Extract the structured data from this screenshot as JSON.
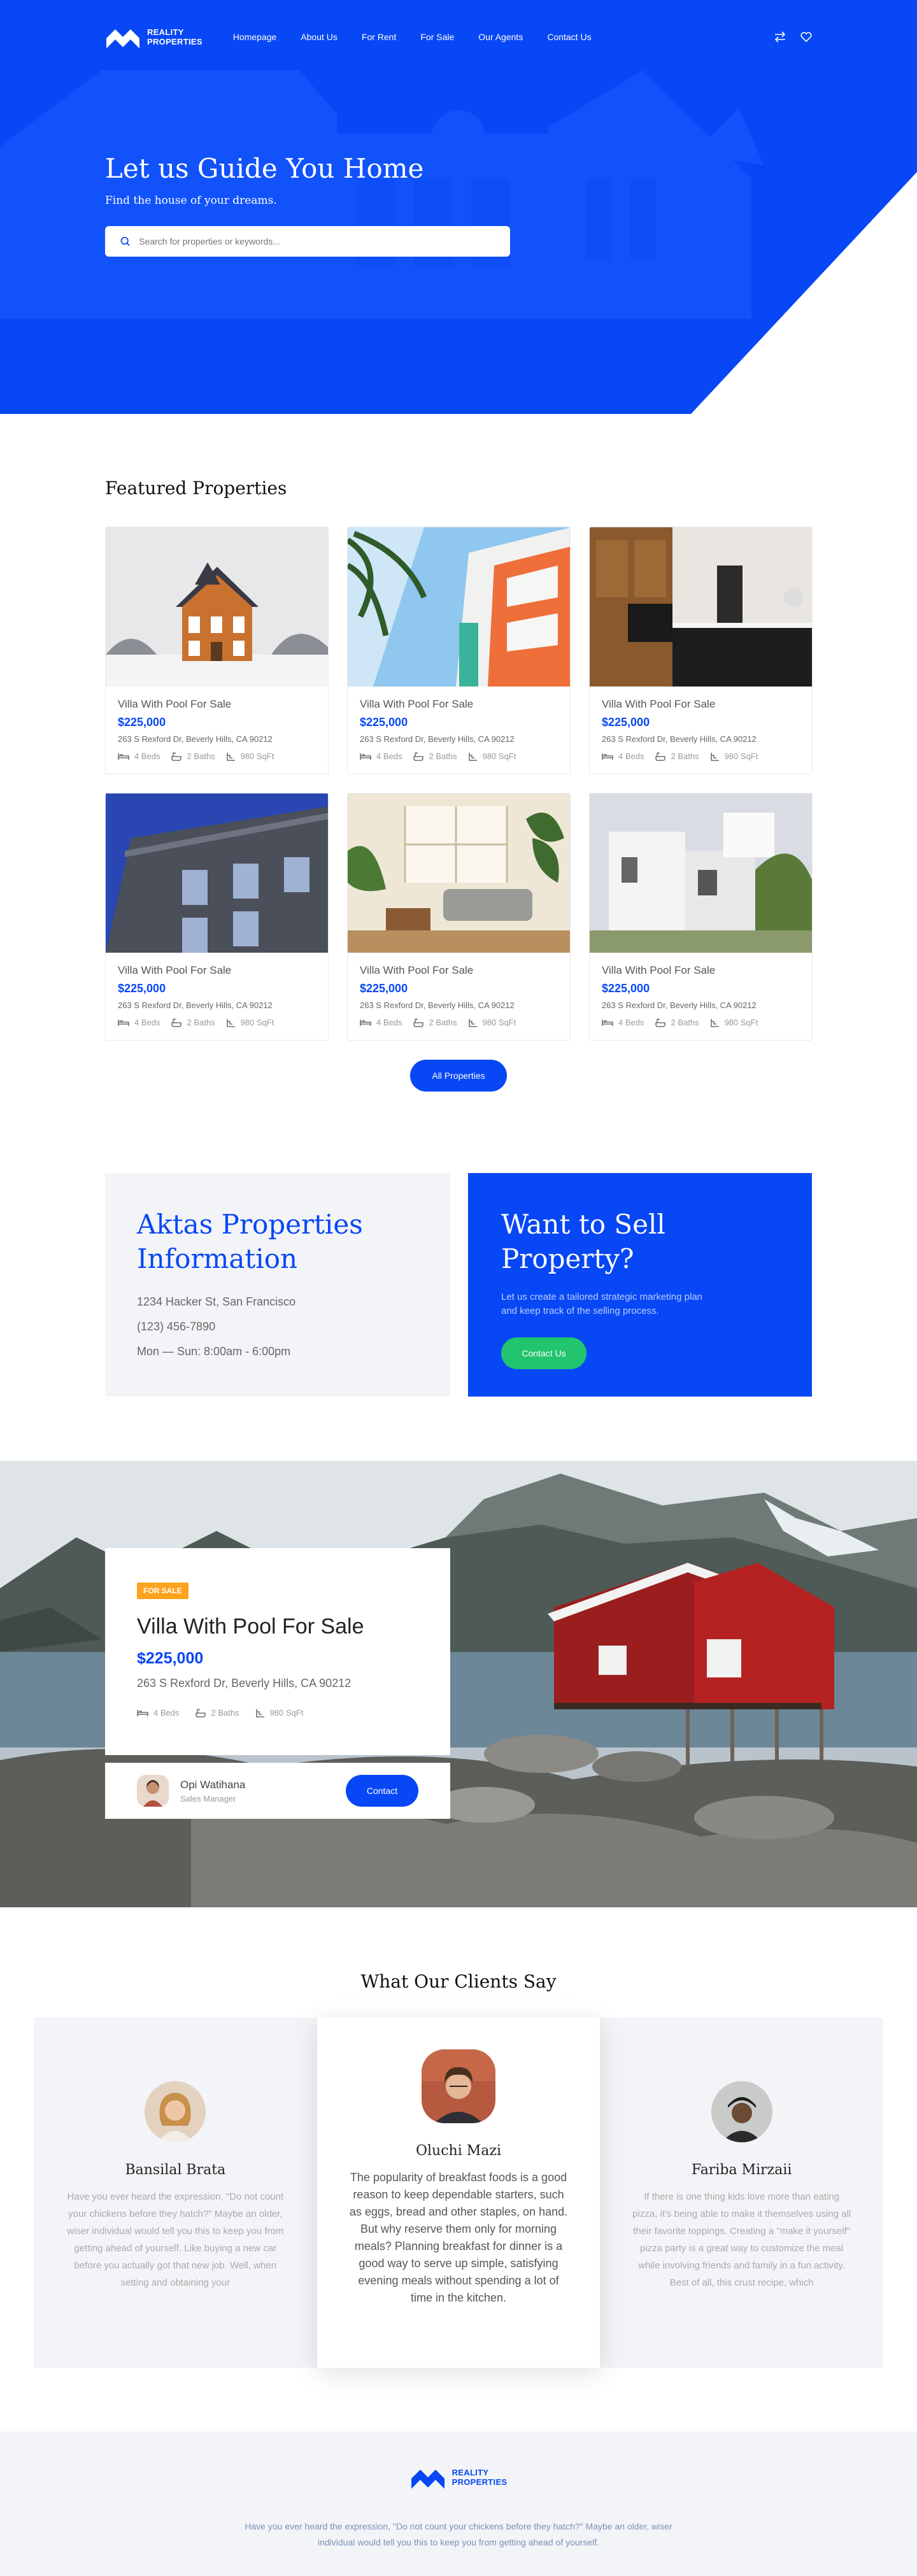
{
  "brand": {
    "line1": "REALITY",
    "line2": "PROPERTIES"
  },
  "nav": {
    "links": [
      "Homepage",
      "About Us",
      "For Rent",
      "For Sale",
      "Our Agents",
      "Contact Us"
    ]
  },
  "hero": {
    "title": "Let us Guide You Home",
    "subtitle": "Find the house of your dreams.",
    "search_placeholder": "Search for properties or keywords..."
  },
  "featured": {
    "title": "Featured Properties",
    "cards": [
      {
        "title": "Villa With Pool For Sale",
        "price": "$225,000",
        "address": "263 S Rexford Dr, Beverly Hills, CA 90212",
        "beds": "4 Beds",
        "baths": "2 Baths",
        "area": "980 SqFt"
      },
      {
        "title": "Villa With Pool For Sale",
        "price": "$225,000",
        "address": "263 S Rexford Dr, Beverly Hills, CA 90212",
        "beds": "4 Beds",
        "baths": "2 Baths",
        "area": "980 SqFt"
      },
      {
        "title": "Villa With Pool For Sale",
        "price": "$225,000",
        "address": "263 S Rexford Dr, Beverly Hills, CA 90212",
        "beds": "4 Beds",
        "baths": "2 Baths",
        "area": "980 SqFt"
      },
      {
        "title": "Villa With Pool For Sale",
        "price": "$225,000",
        "address": "263 S Rexford Dr, Beverly Hills, CA 90212",
        "beds": "4 Beds",
        "baths": "2 Baths",
        "area": "980 SqFt"
      },
      {
        "title": "Villa With Pool For Sale",
        "price": "$225,000",
        "address": "263 S Rexford Dr, Beverly Hills, CA 90212",
        "beds": "4 Beds",
        "baths": "2 Baths",
        "area": "980 SqFt"
      },
      {
        "title": "Villa With Pool For Sale",
        "price": "$225,000",
        "address": "263 S Rexford Dr, Beverly Hills, CA 90212",
        "beds": "4 Beds",
        "baths": "2 Baths",
        "area": "980 SqFt"
      }
    ],
    "all_button": "All Properties"
  },
  "info": {
    "title_line1": "Aktas Properties",
    "title_line2": "Information",
    "address": "1234 Hacker St, San Francisco",
    "phone": "(123) 456-7890",
    "hours": "Mon — Sun: 8:00am - 6:00pm"
  },
  "sell": {
    "title_line1": "Want to Sell",
    "title_line2": "Property?",
    "description": "Let us create a tailored strategic marketing plan and keep track of the selling process.",
    "button": "Contact Us"
  },
  "listing": {
    "badge": "FOR SALE",
    "title": "Villa With Pool For Sale",
    "price": "$225,000",
    "address": "263 S Rexford Dr, Beverly Hills, CA 90212",
    "beds": "4 Beds",
    "baths": "2 Baths",
    "area": "980 SqFt",
    "agent_name": "Opi Watihana",
    "agent_role": "Sales Manager",
    "contact_button": "Contact"
  },
  "testimonials": {
    "title": "What Our Clients Say",
    "items": [
      {
        "name": "Bansilal Brata",
        "text": "Have you ever heard the expression, \"Do not count your chickens before they hatch?\" Maybe an older, wiser individual would tell you this to keep you from getting ahead of yourself. Like buying a new car before you actually got that new job. Well, when setting and obtaining your"
      },
      {
        "name": "Oluchi Mazi",
        "text": "The popularity of breakfast foods is a good reason to keep dependable starters, such as eggs, bread and other staples, on hand. But why reserve them only for morning meals? Planning breakfast for dinner is a good way to serve up simple, satisfying evening meals without spending a lot of time in the kitchen."
      },
      {
        "name": "Fariba Mirzaii",
        "text": "If there is one thing kids love more than eating pizza, it's being able to make it themselves using all their favorite toppings. Creating a \"make it yourself\" pizza party is a great way to customize the meal while involving friends and family in a fun activity. Best of all, this crust recipe, which"
      }
    ]
  },
  "footer": {
    "text": "Have you ever heard the expression, \"Do not count your chickens before they hatch?\" Maybe an older, wiser individual would tell you this to keep you from getting ahead of yourself."
  },
  "colors": {
    "primary": "#0747f5",
    "accent_green": "#22c46e",
    "badge": "#ffa21d",
    "light_bg": "#f3f4f7"
  }
}
